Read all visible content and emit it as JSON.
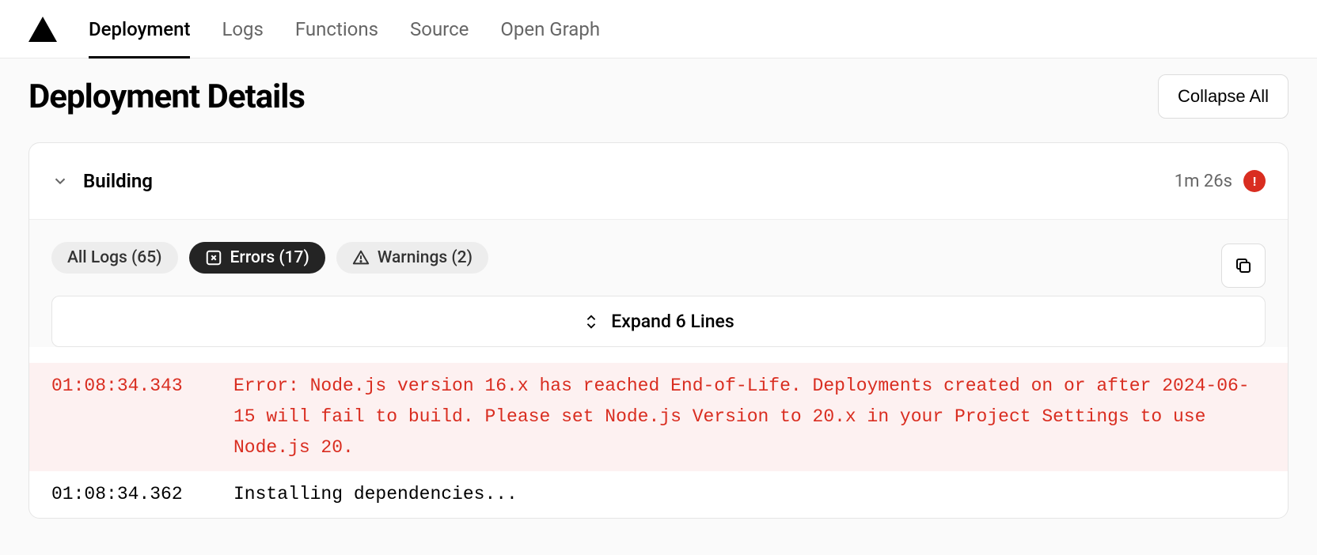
{
  "nav": {
    "tabs": [
      "Deployment",
      "Logs",
      "Functions",
      "Source",
      "Open Graph"
    ],
    "active": 0
  },
  "page": {
    "title": "Deployment Details",
    "collapse_label": "Collapse All"
  },
  "build": {
    "section_title": "Building",
    "duration": "1m 26s",
    "status": "error"
  },
  "filters": {
    "all": "All Logs (65)",
    "errors": "Errors (17)",
    "warnings": "Warnings (2)",
    "active": "errors"
  },
  "expand": {
    "label": "Expand 6 Lines"
  },
  "logs": [
    {
      "time": "01:08:34.343",
      "level": "error",
      "message": "Error: Node.js version 16.x has reached End-of-Life. Deployments created on or after 2024-06-15 will fail to build. Please set Node.js Version to 20.x in your Project Settings to use Node.js 20."
    },
    {
      "time": "01:08:34.362",
      "level": "info",
      "message": "Installing dependencies..."
    }
  ]
}
